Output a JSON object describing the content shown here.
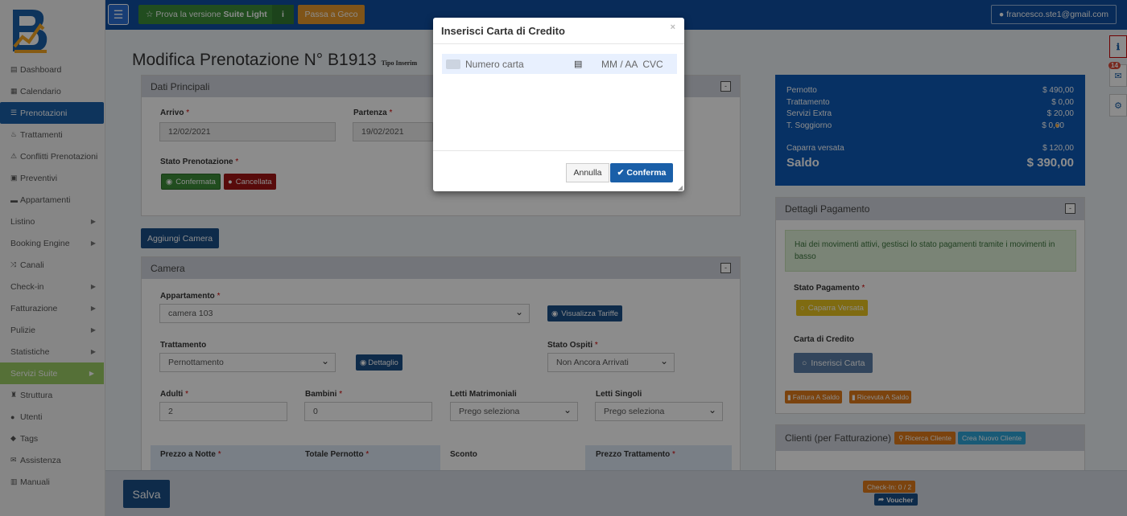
{
  "sidebar": {
    "items": [
      {
        "icon": "dashboard-icon",
        "glyph": "▤",
        "label": "Dashboard"
      },
      {
        "icon": "calendar-icon",
        "glyph": "▦",
        "label": "Calendario"
      },
      {
        "icon": "list-icon",
        "glyph": "☰",
        "label": "Prenotazioni"
      },
      {
        "icon": "cutlery-icon",
        "glyph": "♨",
        "label": "Trattamenti"
      },
      {
        "icon": "warning-icon",
        "glyph": "⚠",
        "label": "Conflitti Prenotazioni"
      },
      {
        "icon": "quote-icon",
        "glyph": "▣",
        "label": "Preventivi"
      },
      {
        "icon": "bed-icon",
        "glyph": "▬",
        "label": "Appartamenti"
      },
      {
        "icon": "",
        "glyph": "",
        "label": "Listino"
      },
      {
        "icon": "",
        "glyph": "",
        "label": "Booking Engine"
      },
      {
        "icon": "shuffle-icon",
        "glyph": "⤨",
        "label": "Canali"
      },
      {
        "icon": "",
        "glyph": "",
        "label": "Check-in"
      },
      {
        "icon": "",
        "glyph": "",
        "label": "Fatturazione"
      },
      {
        "icon": "",
        "glyph": "",
        "label": "Pulizie"
      },
      {
        "icon": "",
        "glyph": "",
        "label": "Statistiche"
      },
      {
        "icon": "",
        "glyph": "",
        "label": "Servizi Suite"
      },
      {
        "icon": "building-icon",
        "glyph": "♜",
        "label": "Struttura"
      },
      {
        "icon": "user-icon",
        "glyph": "●",
        "label": "Utenti"
      },
      {
        "icon": "tags-icon",
        "glyph": "◆",
        "label": "Tags"
      },
      {
        "icon": "support-icon",
        "glyph": "✉",
        "label": "Assistenza"
      },
      {
        "icon": "book-icon",
        "glyph": "▥",
        "label": "Manuali"
      }
    ]
  },
  "topbar": {
    "suite_prefix": "Prova la versione",
    "suite_bold": "Suite Light",
    "info": "i",
    "geco": "Passa a Geco",
    "user": "francesco.ste1@gmail.com"
  },
  "page": {
    "title": "Modifica Prenotazione N° B1913",
    "subtitle": "Tipo Inserim"
  },
  "dati": {
    "header": "Dati Principali",
    "arrivo_label": "Arrivo",
    "arrivo": "12/02/2021",
    "partenza_label": "Partenza",
    "partenza": "19/02/2021",
    "stato_label": "Stato Prenotazione",
    "confermata": "Confermata",
    "cancellata": "Cancellata",
    "aggiungi": "Aggiungi Camera"
  },
  "camera": {
    "header": "Camera",
    "appartamento_label": "Appartamento",
    "appartamento": "camera 103",
    "tariffe": "Visualizza Tariffe",
    "trattamento_label": "Trattamento",
    "trattamento": "Pernottamento",
    "dettaglio": "Dettaglio",
    "stato_ospiti_label": "Stato Ospiti",
    "stato_ospiti": "Non Ancora Arrivati",
    "adulti_label": "Adulti",
    "adulti": "2",
    "bambini_label": "Bambini",
    "bambini": "0",
    "matrimoniali_label": "Letti Matrimoniali",
    "matrimoniali": "Prego seleziona",
    "singoli_label": "Letti Singoli",
    "singoli": "Prego seleziona",
    "prezzo_notte": "Prezzo a Notte",
    "totale_pernotto": "Totale Pernotto",
    "sconto": "Sconto",
    "prezzo_trattamento": "Prezzo Trattamento"
  },
  "summary": {
    "rows": [
      {
        "label": "Pernotto",
        "value": "$ 490,00"
      },
      {
        "label": "Trattamento",
        "value": "$ 0,00"
      },
      {
        "label": "Servizi Extra",
        "value": "$ 20,00"
      },
      {
        "label": "T. Soggiorno",
        "value": "$ 0,00"
      }
    ],
    "caparra_label": "Caparra versata",
    "caparra": "$ 120,00",
    "saldo_label": "Saldo",
    "saldo": "$ 390,00"
  },
  "pagamento": {
    "header": "Dettagli Pagamento",
    "alert": "Hai dei movimenti attivi, gestisci lo stato pagamenti tramite i movimenti in basso",
    "stato_label": "Stato Pagamento",
    "stato": "Caparra Versata",
    "carta_label": "Carta di Credito",
    "inserisci": "Inserisci Carta",
    "fattura": "Fattura A Saldo",
    "ricevuta": "Ricevuta A Saldo"
  },
  "clienti": {
    "header": "Clienti (per Fatturazione)",
    "ricerca": "Ricerca Cliente",
    "nuovo": "Crea Nuovo Cliente"
  },
  "bottom": {
    "salva": "Salva",
    "checkin": "Check-In: 0 / 2",
    "voucher": "Voucher"
  },
  "side_badge": "14",
  "modal": {
    "title": "Inserisci Carta di Credito",
    "close": "×",
    "card_placeholder": "Numero carta",
    "exp_placeholder": "MM / AA",
    "cvc_placeholder": "CVC",
    "annulla": "Annulla",
    "conferma": "Conferma"
  },
  "colors": {
    "primary": "#0f4fa2",
    "success": "#3c8d3a",
    "warning": "#e89a2c",
    "danger": "#a01414"
  }
}
